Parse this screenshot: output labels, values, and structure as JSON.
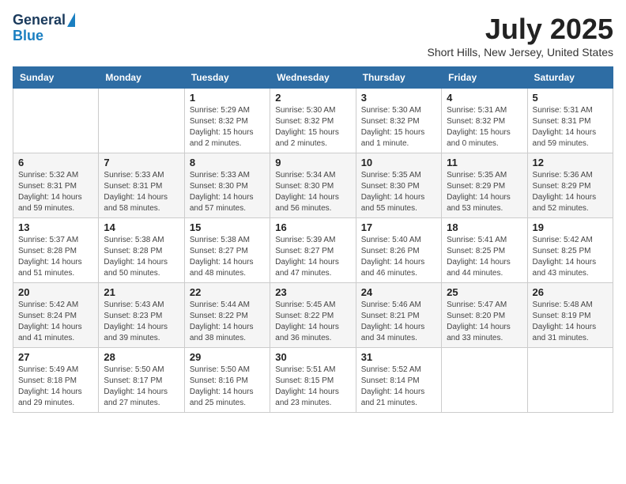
{
  "header": {
    "logo_line1": "General",
    "logo_line2": "Blue",
    "month_year": "July 2025",
    "location": "Short Hills, New Jersey, United States"
  },
  "days_of_week": [
    "Sunday",
    "Monday",
    "Tuesday",
    "Wednesday",
    "Thursday",
    "Friday",
    "Saturday"
  ],
  "weeks": [
    [
      {
        "num": "",
        "info": ""
      },
      {
        "num": "",
        "info": ""
      },
      {
        "num": "1",
        "info": "Sunrise: 5:29 AM\nSunset: 8:32 PM\nDaylight: 15 hours\nand 2 minutes."
      },
      {
        "num": "2",
        "info": "Sunrise: 5:30 AM\nSunset: 8:32 PM\nDaylight: 15 hours\nand 2 minutes."
      },
      {
        "num": "3",
        "info": "Sunrise: 5:30 AM\nSunset: 8:32 PM\nDaylight: 15 hours\nand 1 minute."
      },
      {
        "num": "4",
        "info": "Sunrise: 5:31 AM\nSunset: 8:32 PM\nDaylight: 15 hours\nand 0 minutes."
      },
      {
        "num": "5",
        "info": "Sunrise: 5:31 AM\nSunset: 8:31 PM\nDaylight: 14 hours\nand 59 minutes."
      }
    ],
    [
      {
        "num": "6",
        "info": "Sunrise: 5:32 AM\nSunset: 8:31 PM\nDaylight: 14 hours\nand 59 minutes."
      },
      {
        "num": "7",
        "info": "Sunrise: 5:33 AM\nSunset: 8:31 PM\nDaylight: 14 hours\nand 58 minutes."
      },
      {
        "num": "8",
        "info": "Sunrise: 5:33 AM\nSunset: 8:30 PM\nDaylight: 14 hours\nand 57 minutes."
      },
      {
        "num": "9",
        "info": "Sunrise: 5:34 AM\nSunset: 8:30 PM\nDaylight: 14 hours\nand 56 minutes."
      },
      {
        "num": "10",
        "info": "Sunrise: 5:35 AM\nSunset: 8:30 PM\nDaylight: 14 hours\nand 55 minutes."
      },
      {
        "num": "11",
        "info": "Sunrise: 5:35 AM\nSunset: 8:29 PM\nDaylight: 14 hours\nand 53 minutes."
      },
      {
        "num": "12",
        "info": "Sunrise: 5:36 AM\nSunset: 8:29 PM\nDaylight: 14 hours\nand 52 minutes."
      }
    ],
    [
      {
        "num": "13",
        "info": "Sunrise: 5:37 AM\nSunset: 8:28 PM\nDaylight: 14 hours\nand 51 minutes."
      },
      {
        "num": "14",
        "info": "Sunrise: 5:38 AM\nSunset: 8:28 PM\nDaylight: 14 hours\nand 50 minutes."
      },
      {
        "num": "15",
        "info": "Sunrise: 5:38 AM\nSunset: 8:27 PM\nDaylight: 14 hours\nand 48 minutes."
      },
      {
        "num": "16",
        "info": "Sunrise: 5:39 AM\nSunset: 8:27 PM\nDaylight: 14 hours\nand 47 minutes."
      },
      {
        "num": "17",
        "info": "Sunrise: 5:40 AM\nSunset: 8:26 PM\nDaylight: 14 hours\nand 46 minutes."
      },
      {
        "num": "18",
        "info": "Sunrise: 5:41 AM\nSunset: 8:25 PM\nDaylight: 14 hours\nand 44 minutes."
      },
      {
        "num": "19",
        "info": "Sunrise: 5:42 AM\nSunset: 8:25 PM\nDaylight: 14 hours\nand 43 minutes."
      }
    ],
    [
      {
        "num": "20",
        "info": "Sunrise: 5:42 AM\nSunset: 8:24 PM\nDaylight: 14 hours\nand 41 minutes."
      },
      {
        "num": "21",
        "info": "Sunrise: 5:43 AM\nSunset: 8:23 PM\nDaylight: 14 hours\nand 39 minutes."
      },
      {
        "num": "22",
        "info": "Sunrise: 5:44 AM\nSunset: 8:22 PM\nDaylight: 14 hours\nand 38 minutes."
      },
      {
        "num": "23",
        "info": "Sunrise: 5:45 AM\nSunset: 8:22 PM\nDaylight: 14 hours\nand 36 minutes."
      },
      {
        "num": "24",
        "info": "Sunrise: 5:46 AM\nSunset: 8:21 PM\nDaylight: 14 hours\nand 34 minutes."
      },
      {
        "num": "25",
        "info": "Sunrise: 5:47 AM\nSunset: 8:20 PM\nDaylight: 14 hours\nand 33 minutes."
      },
      {
        "num": "26",
        "info": "Sunrise: 5:48 AM\nSunset: 8:19 PM\nDaylight: 14 hours\nand 31 minutes."
      }
    ],
    [
      {
        "num": "27",
        "info": "Sunrise: 5:49 AM\nSunset: 8:18 PM\nDaylight: 14 hours\nand 29 minutes."
      },
      {
        "num": "28",
        "info": "Sunrise: 5:50 AM\nSunset: 8:17 PM\nDaylight: 14 hours\nand 27 minutes."
      },
      {
        "num": "29",
        "info": "Sunrise: 5:50 AM\nSunset: 8:16 PM\nDaylight: 14 hours\nand 25 minutes."
      },
      {
        "num": "30",
        "info": "Sunrise: 5:51 AM\nSunset: 8:15 PM\nDaylight: 14 hours\nand 23 minutes."
      },
      {
        "num": "31",
        "info": "Sunrise: 5:52 AM\nSunset: 8:14 PM\nDaylight: 14 hours\nand 21 minutes."
      },
      {
        "num": "",
        "info": ""
      },
      {
        "num": "",
        "info": ""
      }
    ]
  ]
}
